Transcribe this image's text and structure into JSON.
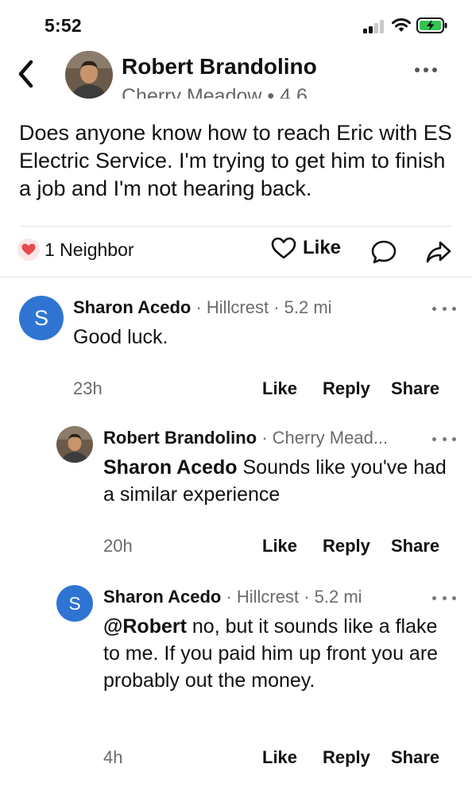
{
  "status_bar": {
    "time": "5:52"
  },
  "header": {
    "author": "Robert Brandolino",
    "subtitle": "Cherry Meadow • 4.6"
  },
  "post": {
    "body": "Does anyone know how to reach Eric with ES Electric Service. I'm trying to get him to finish a job and I'm not hearing back.",
    "reaction_count": "1 Neighbor",
    "like_label": "Like"
  },
  "comments": [
    {
      "initial": "S",
      "author": "Sharon Acedo",
      "location": " · Hillcrest · 5.2 mi",
      "mention": "",
      "text": "Good luck.",
      "time": "23h",
      "like": "Like",
      "reply": "Reply",
      "share": "Share"
    },
    {
      "initial": "",
      "author": "Robert Brandolino",
      "location": " · Cherry Mead...",
      "mention": "Sharon Acedo",
      "text": " Sounds like you've had a similar experience",
      "time": "20h",
      "like": "Like",
      "reply": "Reply",
      "share": "Share"
    },
    {
      "initial": "S",
      "author": "Sharon Acedo",
      "location": " · Hillcrest · 5.2 mi",
      "mention": "@Robert",
      "text": " no, but it sounds like a flake to me. If you paid him up front you are probably out the money.",
      "time": "4h",
      "like": "Like",
      "reply": "Reply",
      "share": "Share"
    }
  ],
  "colors": {
    "avatar_blue": "#2f74d2",
    "heart_red": "#e5484d",
    "muted_text": "#6b6b6b"
  },
  "icons": [
    "back-chevron-icon",
    "more-dots-icon",
    "heart-icon",
    "comment-bubble-icon",
    "share-arrow-icon",
    "signal-icon",
    "wifi-icon",
    "battery-charging-icon"
  ]
}
